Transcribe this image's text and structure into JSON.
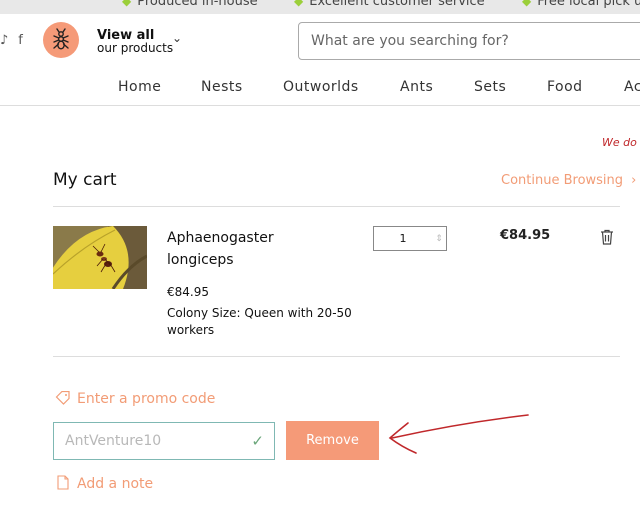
{
  "banner": {
    "items": [
      "Produced in-house",
      "Excellent customer service",
      "Free local pick up"
    ]
  },
  "header": {
    "social_icons": [
      "tiktok-icon",
      "facebook-icon"
    ],
    "logo_icon": "ant-icon",
    "view_all_title": "View all",
    "view_all_sub": "our products",
    "search_placeholder": "What are you searching for?"
  },
  "nav": {
    "items": [
      "Home",
      "Nests",
      "Outworlds",
      "Ants",
      "Sets",
      "Food",
      "Ac"
    ]
  },
  "notice": "We do",
  "cart": {
    "title": "My cart",
    "continue_label": "Continue Browsing",
    "item": {
      "name_line1": "Aphaenogaster",
      "name_line2": "longiceps",
      "price": "€84.95",
      "option_line1": "Colony Size: Queen with 20-50",
      "option_line2": "workers",
      "quantity": "1",
      "line_total": "€84.95"
    }
  },
  "promo": {
    "link_label": "Enter a promo code",
    "code_value": "AntVenture10",
    "remove_label": "Remove"
  },
  "note": {
    "link_label": "Add a note"
  },
  "colors": {
    "accent": "#f59a78",
    "accent_text": "#f29c76",
    "notice": "#c0282b",
    "annotation_arrow": "#c0282b"
  }
}
